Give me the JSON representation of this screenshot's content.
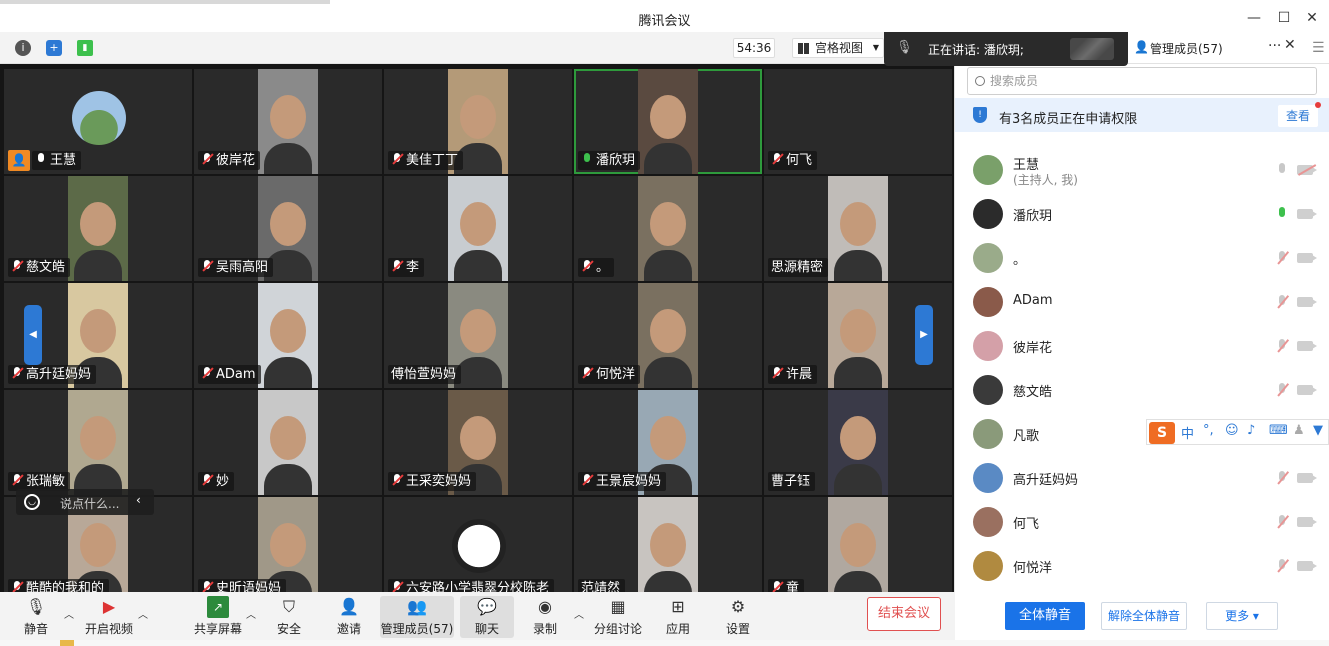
{
  "window": {
    "title": "腾讯会议",
    "minimize": "—",
    "maximize": "☐",
    "close": "✕"
  },
  "toolbar": {
    "timer": "54:36",
    "view_label": "宫格视图"
  },
  "speaking": {
    "text": "正在讲话: 潘欣玥;"
  },
  "members_panel": {
    "title": "管理成员(57)",
    "search_placeholder": "搜索成员",
    "request_text": "有3名成员正在申请权限",
    "request_button": "查看",
    "members": [
      {
        "name": "王慧",
        "sub": "(主持人, 我)",
        "mic": "muted-host",
        "avatar_color": "#7aa06a"
      },
      {
        "name": "潘欣玥",
        "sub": "",
        "mic": "on",
        "avatar_color": "#2b2b2b"
      },
      {
        "name": "。",
        "sub": "",
        "mic": "off",
        "avatar_color": "#9aab8a"
      },
      {
        "name": "ADam",
        "sub": "",
        "mic": "off",
        "avatar_color": "#8a5a4a"
      },
      {
        "name": "彼岸花",
        "sub": "",
        "mic": "off",
        "avatar_color": "#d4a0a8"
      },
      {
        "name": "慈文皓",
        "sub": "",
        "mic": "off",
        "avatar_color": "#3a3a3a"
      },
      {
        "name": "凡歌",
        "sub": "",
        "mic": "off",
        "avatar_color": "#8a9a7a"
      },
      {
        "name": "高升廷妈妈",
        "sub": "",
        "mic": "off",
        "avatar_color": "#5a8ac4"
      },
      {
        "name": "何飞",
        "sub": "",
        "mic": "off",
        "avatar_color": "#9a7060"
      },
      {
        "name": "何悦洋",
        "sub": "",
        "mic": "off",
        "avatar_color": "#b08a40"
      }
    ],
    "mute_all": "全体静音",
    "unmute_all": "解除全体静音",
    "more": "更多 ▾"
  },
  "tiles": [
    {
      "name": "王慧",
      "mic": "on",
      "host": true,
      "bg": "#2d2d2d",
      "face": false
    },
    {
      "name": "彼岸花",
      "mic": "off",
      "bg": "#3a3836",
      "face": true,
      "face_bg": "#8a8a8a"
    },
    {
      "name": "美佳丁丁",
      "mic": "off",
      "bg": "#a08a70",
      "face": true,
      "face_bg": "#b49a78"
    },
    {
      "name": "潘欣玥",
      "mic": "green",
      "active": true,
      "bg": "#3a2f2a",
      "face": true,
      "face_bg": "#5a4a40"
    },
    {
      "name": "何飞",
      "mic": "off",
      "bg": "#202020",
      "face": false
    },
    {
      "name": "慈文皓",
      "mic": "off",
      "bg": "#4a5a3a",
      "face": true,
      "face_bg": "#5c6a48"
    },
    {
      "name": "吴雨高阳",
      "mic": "off",
      "bg": "#2e2e2e",
      "face": true,
      "face_bg": "#6a6a6a"
    },
    {
      "name": "李",
      "mic": "off",
      "bg": "#2a2a2a",
      "face": true,
      "face_bg": "#c8ccd0"
    },
    {
      "name": "。",
      "mic": "off",
      "bg": "#2a2a2a",
      "face": true,
      "face_bg": "#7a7060"
    },
    {
      "name": "思源精密",
      "mic": "none",
      "bg": "#2a2a2a",
      "face": true,
      "face_bg": "#c0bcb8"
    },
    {
      "name": "高升廷妈妈",
      "mic": "off",
      "bg": "#2a2a2a",
      "face": true,
      "face_bg": "#d8c8a0"
    },
    {
      "name": "ADam",
      "mic": "off",
      "bg": "#2a2a2a",
      "face": true,
      "face_bg": "#d0d4d8"
    },
    {
      "name": "傅怡萱妈妈",
      "mic": "none",
      "bg": "#2a2a2a",
      "face": true,
      "face_bg": "#8a8a80"
    },
    {
      "name": "何悦洋",
      "mic": "off",
      "bg": "#2a2a2a",
      "face": true,
      "face_bg": "#7a7060"
    },
    {
      "name": "许晨",
      "mic": "off",
      "bg": "#c8b8a8",
      "face": true,
      "face_bg": "#b8a898"
    },
    {
      "name": "张瑞敏",
      "mic": "off",
      "bg": "#2a2a2a",
      "face": true,
      "face_bg": "#b0a890"
    },
    {
      "name": "妙",
      "mic": "off",
      "bg": "#d0d0d0",
      "face": true,
      "face_bg": "#c8c8c8"
    },
    {
      "name": "王采奕妈妈",
      "mic": "off",
      "bg": "#5a4a3a",
      "face": true,
      "face_bg": "#6a5a48"
    },
    {
      "name": "王景宸妈妈",
      "mic": "off",
      "bg": "#8a9aa8",
      "face": true,
      "face_bg": "#98a8b4"
    },
    {
      "name": "曹子钰",
      "mic": "none",
      "bg": "#2a2a2a",
      "face": true,
      "face_bg": "#3a3a48"
    },
    {
      "name": "酷酷的我和的",
      "mic": "off",
      "bg": "#a89888",
      "face": true,
      "face_bg": "#b8a898"
    },
    {
      "name": "史昕语妈妈",
      "mic": "off",
      "bg": "#2a2a2a",
      "face": true,
      "face_bg": "#a09888"
    },
    {
      "name": "六安路小学翡翠分校陈老",
      "mic": "off",
      "bg": "#2a2a2a",
      "face": false,
      "avatar": true
    },
    {
      "name": "范靖然",
      "mic": "none",
      "bg": "#2a2a2a",
      "face": true,
      "face_bg": "#c8c4c0"
    },
    {
      "name": "童",
      "mic": "off",
      "bg": "#2a2a2a",
      "face": true,
      "face_bg": "#b0a8a0"
    }
  ],
  "chat": {
    "placeholder": "说点什么..."
  },
  "bottombar": {
    "mute": "静音",
    "video": "开启视频",
    "share": "共享屏幕",
    "security": "安全",
    "invite": "邀请",
    "members": "管理成员(57)",
    "chat": "聊天",
    "record": "录制",
    "breakout": "分组讨论",
    "apps": "应用",
    "settings": "设置",
    "end": "结束会议"
  },
  "ime": {
    "logo": "S",
    "mode": "中"
  }
}
